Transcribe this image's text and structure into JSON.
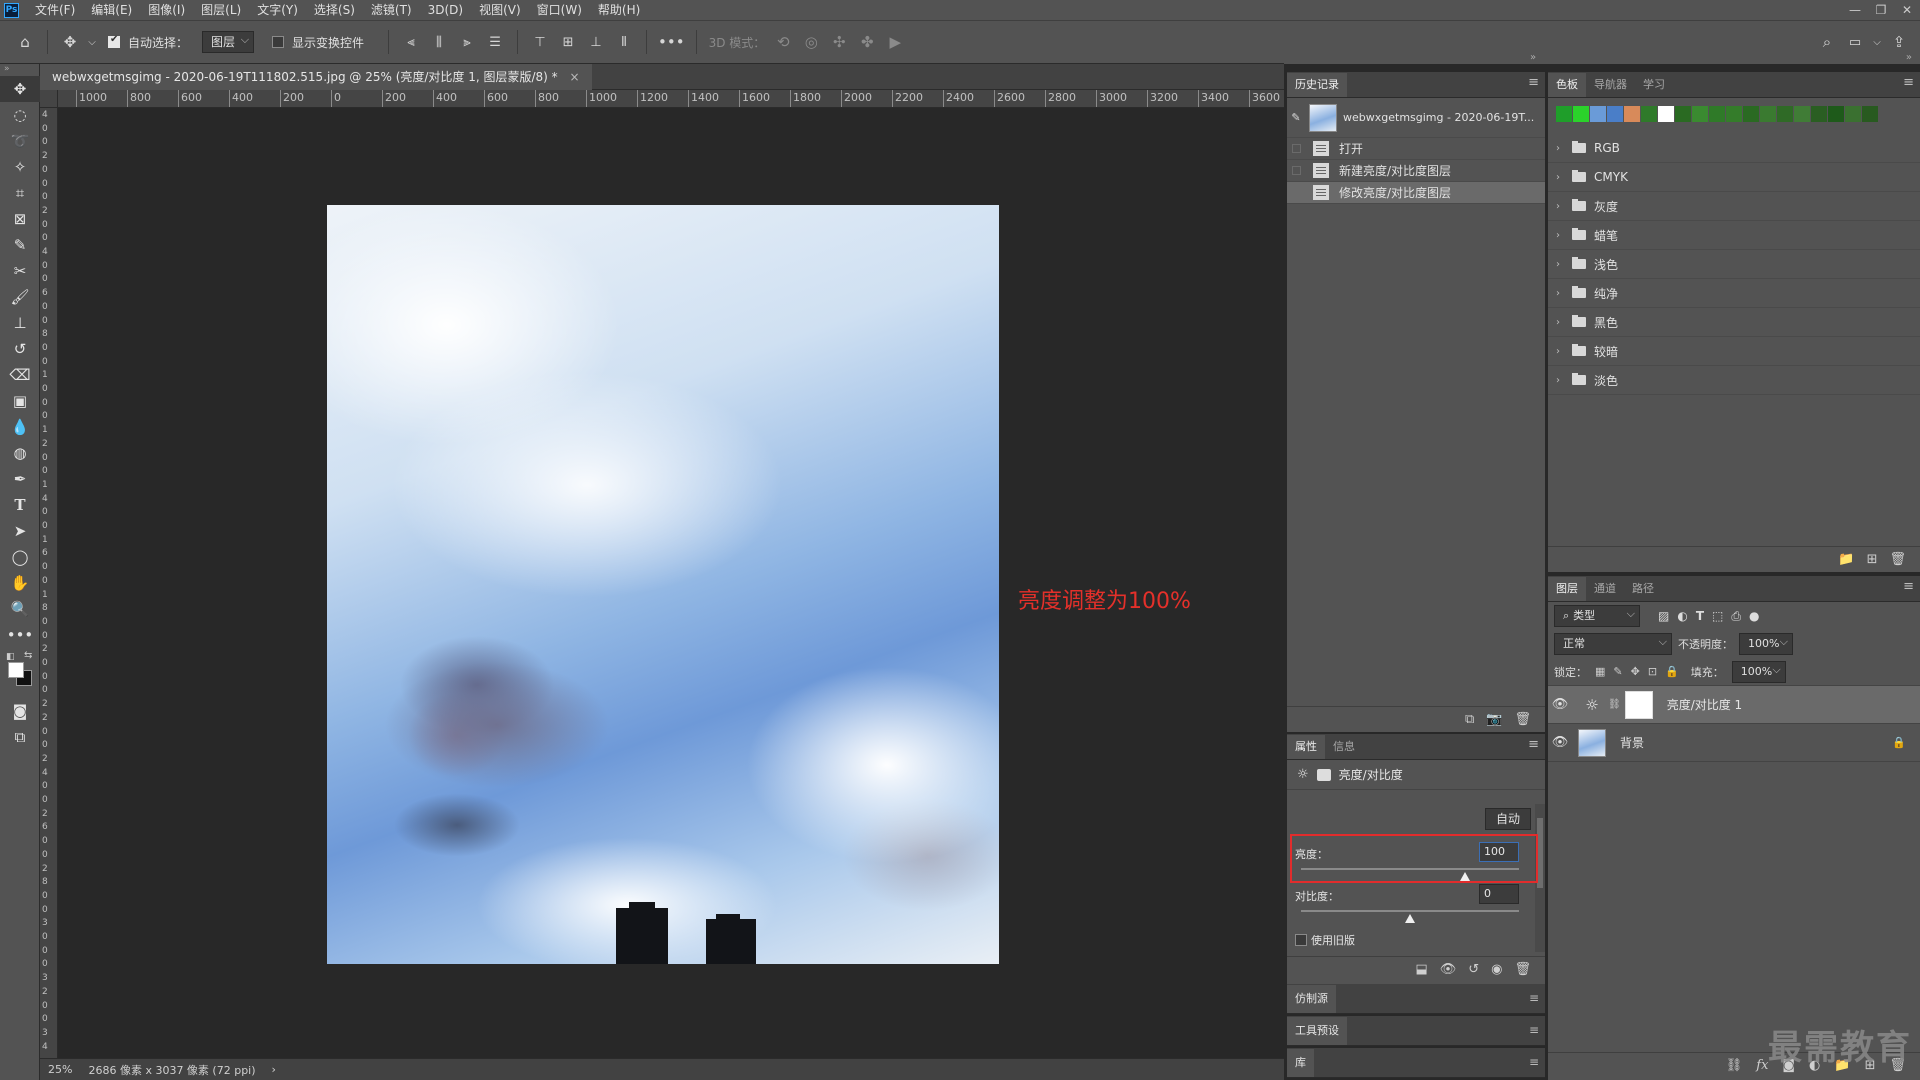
{
  "app": {
    "logo": "Ps"
  },
  "menu": [
    "文件(F)",
    "编辑(E)",
    "图像(I)",
    "图层(L)",
    "文字(Y)",
    "选择(S)",
    "滤镜(T)",
    "3D(D)",
    "视图(V)",
    "窗口(W)",
    "帮助(H)"
  ],
  "window_controls": {
    "minimize": "—",
    "restore": "❐",
    "close": "✕"
  },
  "options_bar": {
    "auto_select_label": "自动选择：",
    "auto_select_checked": true,
    "auto_select_target": "图层",
    "show_transform_label": "显示变换控件",
    "mode_3d_label": "3D 模式："
  },
  "document": {
    "tab_title": "webwxgetmsgimg - 2020-06-19T111802.515.jpg @ 25% (亮度/对比度 1, 图层蒙版/8) *",
    "tab_close": "×",
    "ruler_h": [
      "1000",
      "800",
      "600",
      "400",
      "200",
      "0",
      "200",
      "400",
      "600",
      "800",
      "1000",
      "1200",
      "1400",
      "1600",
      "1800",
      "2000",
      "2200",
      "2400",
      "2600",
      "2800",
      "3000",
      "3200",
      "3400",
      "3600"
    ],
    "ruler_v": [
      "4",
      "0",
      "0",
      "2",
      "0",
      "0",
      "0",
      "2",
      "0",
      "0",
      "4",
      "0",
      "0",
      "6",
      "0",
      "0",
      "8",
      "0",
      "0",
      "1",
      "0",
      "0",
      "0",
      "1",
      "2",
      "0",
      "0",
      "1",
      "4",
      "0",
      "0",
      "1",
      "6",
      "0",
      "0",
      "1",
      "8",
      "0",
      "0",
      "2",
      "0",
      "0",
      "0",
      "2",
      "2",
      "0",
      "0",
      "2",
      "4",
      "0",
      "0",
      "2",
      "6",
      "0",
      "0",
      "2",
      "8",
      "0",
      "0",
      "3",
      "0",
      "0",
      "0",
      "3",
      "2",
      "0",
      "0",
      "3",
      "4"
    ],
    "annotation": "亮度调整为100%"
  },
  "status_bar": {
    "zoom": "25%",
    "doc_size": "2686 像素 x 3037 像素 (72 ppi)",
    "arrow": "›"
  },
  "history": {
    "tab": "历史记录",
    "snapshot": "webwxgetmsgimg - 2020-06-19T...",
    "items": [
      "打开",
      "新建亮度/对比度图层",
      "修改亮度/对比度图层"
    ]
  },
  "properties": {
    "tabs": [
      "属性",
      "信息"
    ],
    "title": "亮度/对比度",
    "auto_button": "自动",
    "brightness_label": "亮度：",
    "brightness_value": "100",
    "brightness_fraction": 0.75,
    "contrast_label": "对比度：",
    "contrast_value": "0",
    "contrast_fraction": 0.5,
    "legacy_label": "使用旧版",
    "legacy_checked": false
  },
  "collapsed_panels": [
    "仿制源",
    "工具预设",
    "库"
  ],
  "swatches": {
    "tabs": [
      "色板",
      "导航器",
      "学习"
    ],
    "recent_colors": [
      "#1f9e2a",
      "#2bd22b",
      "#6a9bd8",
      "#4a7ec8",
      "#d88a5a",
      "#2f7a2a",
      "#ffffff",
      "#2a6a22",
      "#3a8a30",
      "#2f7a28",
      "#347c2a",
      "#2a6a22",
      "#3a7a30",
      "#2f6a26",
      "#407c36",
      "#2a5e22",
      "#1e5a1a",
      "#3a7030",
      "#285a20"
    ],
    "groups": [
      "RGB",
      "CMYK",
      "灰度",
      "蜡笔",
      "浅色",
      "纯净",
      "黑色",
      "较暗",
      "淡色"
    ]
  },
  "layers": {
    "tabs": [
      "图层",
      "通道",
      "路径"
    ],
    "filter_kind": "类型",
    "blend_mode": "正常",
    "opacity_label": "不透明度：",
    "opacity_value": "100%",
    "lock_label": "锁定：",
    "fill_label": "填充：",
    "fill_value": "100%",
    "items": [
      {
        "name": "亮度/对比度 1",
        "selected": true
      },
      {
        "name": "背景",
        "selected": false
      }
    ],
    "footer_icons": [
      "link-icon",
      "fx-icon",
      "mask-icon",
      "adjustment-icon",
      "group-icon",
      "new-layer-icon",
      "trash-icon"
    ]
  },
  "watermark": "最需教育",
  "colors": {
    "annotation": "#e4302a",
    "highlight_box": "#e22c2c",
    "panel_bg": "#535353",
    "canvas_bg": "#282828"
  }
}
